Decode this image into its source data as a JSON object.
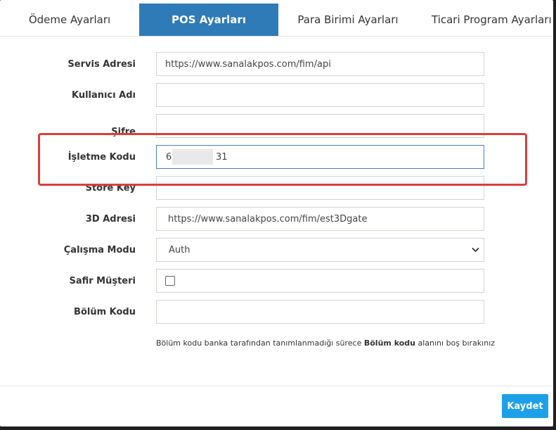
{
  "tabs": [
    {
      "label": "Ödeme Ayarları"
    },
    {
      "label": "POS Ayarları"
    },
    {
      "label": "Para Birimi Ayarları"
    },
    {
      "label": "Ticari Program Ayarları"
    }
  ],
  "active_tab": "POS Ayarları",
  "form": {
    "service_address": {
      "label": "Servis Adresi",
      "value": "https://www.sanalakpos.com/fim/api"
    },
    "username": {
      "label": "Kullanıcı Adı",
      "value": ""
    },
    "password": {
      "label": "Şifre",
      "value": ""
    },
    "merchant_code": {
      "label": "İşletme Kodu",
      "value_start": "6",
      "value_end": "31"
    },
    "store_key": {
      "label": "Store Key",
      "value": ""
    },
    "threed_address": {
      "label": "3D Adresi",
      "value": "https://www.sanalakpos.com/fim/est3Dgate"
    },
    "work_mode": {
      "label": "Çalışma Modu",
      "value": "Auth"
    },
    "safir_customer": {
      "label": "Safir Müşteri",
      "checked": false
    },
    "section_code": {
      "label": "Bölüm Kodu",
      "value": ""
    }
  },
  "help": {
    "before": "Bölüm kodu banka tarafından tanımlanmadığı sürece ",
    "bold": "Bölüm kodu",
    "after": " alanını boş bırakınız"
  },
  "footer": {
    "save_label": "Kaydet"
  },
  "colors": {
    "active_tab": "#2e7bb8",
    "save_button": "#1ea0e8",
    "highlight": "#d93f3f"
  }
}
